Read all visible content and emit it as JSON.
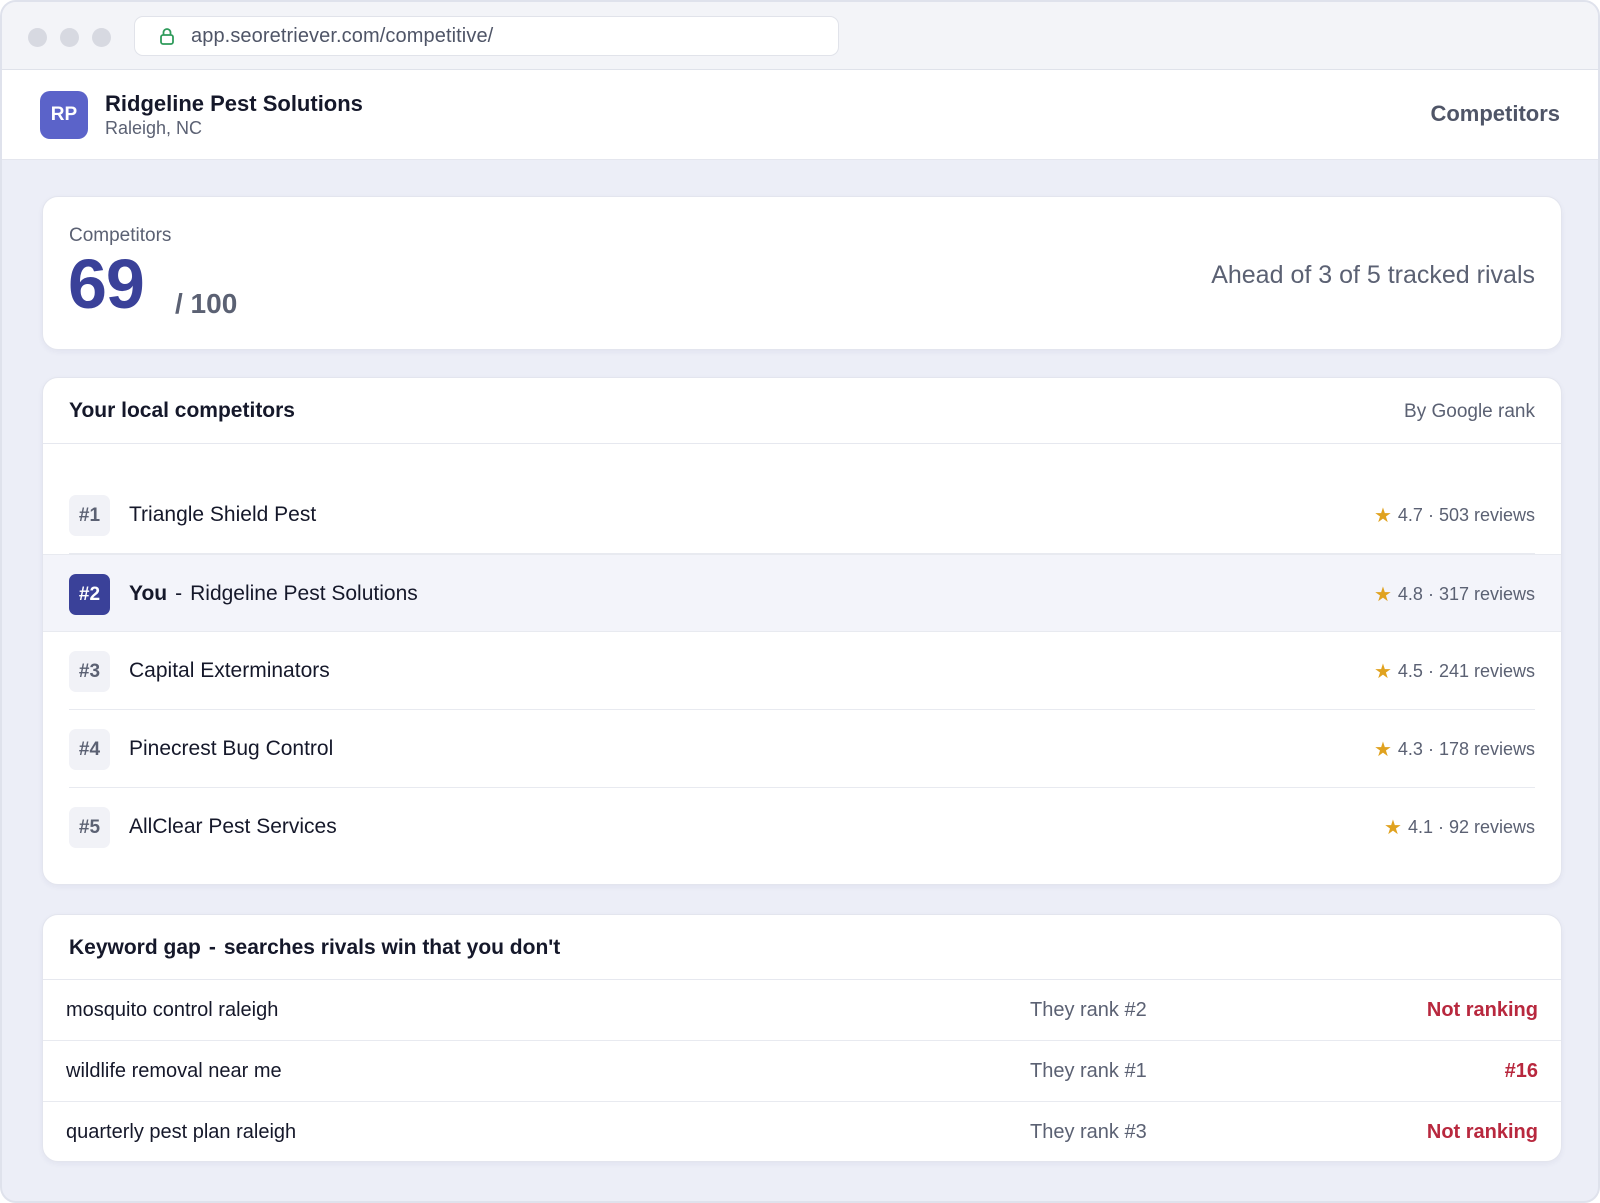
{
  "browser": {
    "url": "app.seoretriever.com/competitive/"
  },
  "header": {
    "avatar_initials": "RP",
    "business_name": "Ridgeline Pest Solutions",
    "location": "Raleigh, NC",
    "page_title": "Competitors"
  },
  "score": {
    "label": "Competitors",
    "value": "69",
    "max": "/ 100",
    "summary": "Ahead of 3 of 5 tracked rivals"
  },
  "competitors": {
    "title": "Your local competitors",
    "sort_label": "By Google rank",
    "rows": [
      {
        "rank": "#1",
        "name": "Triangle Shield Pest",
        "rating": "4.7 · 503 reviews"
      },
      {
        "rank": "#2",
        "you_label": "You",
        "separator": "-",
        "name": "Ridgeline Pest Solutions",
        "rating": "4.8 · 317 reviews"
      },
      {
        "rank": "#3",
        "name": "Capital Exterminators",
        "rating": "4.5 · 241 reviews"
      },
      {
        "rank": "#4",
        "name": "Pinecrest Bug Control",
        "rating": "4.3 · 178 reviews"
      },
      {
        "rank": "#5",
        "name": "AllClear Pest Services",
        "rating": "4.1 · 92 reviews"
      }
    ]
  },
  "keyword_gap": {
    "title": "Keyword gap",
    "separator": "-",
    "subtitle": "searches rivals win that you don't",
    "rows": [
      {
        "keyword": "mosquito control raleigh",
        "they": "They rank #2",
        "you": "Not ranking"
      },
      {
        "keyword": "wildlife removal near me",
        "they": "They rank #1",
        "you": "#16"
      },
      {
        "keyword": "quarterly pest plan raleigh",
        "they": "They rank #3",
        "you": "Not ranking"
      }
    ]
  },
  "icons": {
    "lock": "lock-icon",
    "star": "star-icon"
  },
  "colors": {
    "brand": "#3a4199",
    "avatar": "#5b63c9",
    "star": "#e0a21f",
    "alert": "#b8283e"
  }
}
